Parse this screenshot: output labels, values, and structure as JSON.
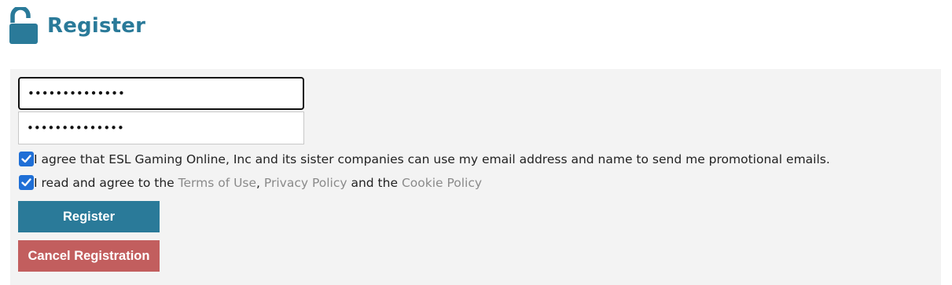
{
  "header": {
    "title": "Register",
    "icon": "unlock-icon",
    "title_color": "#2a7a99"
  },
  "form": {
    "password_value": "••••••••••••••",
    "confirm_password_value": "••••••••••••••",
    "checkboxes": [
      {
        "checked": true,
        "text": "I agree that ESL Gaming Online, Inc and its sister companies can use my email address and name to send me promotional emails."
      },
      {
        "checked": true,
        "text_before": "I read and agree to the ",
        "terms_link": "Terms of Use",
        "comma": ", ",
        "privacy_link": "Privacy Policy",
        "and_the": " and the ",
        "cookie_link": "Cookie Policy"
      }
    ],
    "register_label": "Register",
    "cancel_label": "Cancel Registration"
  },
  "colors": {
    "accent": "#2a7a99",
    "cancel": "#c25e5e",
    "checkbox": "#1f6fd6",
    "panel_bg": "#f3f3f3",
    "link": "#8a8a8a"
  }
}
